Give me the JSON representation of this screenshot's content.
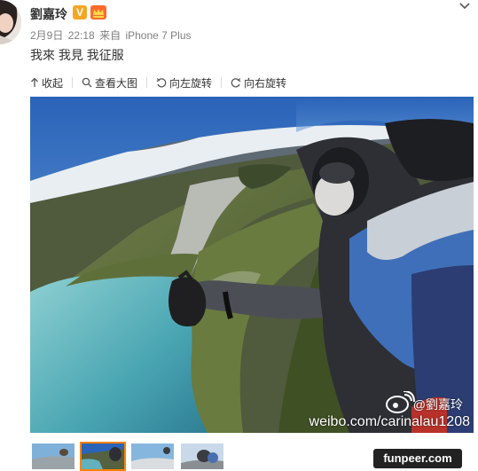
{
  "post": {
    "username": "劉嘉玲",
    "verified_badge": "V",
    "date": "2月9日",
    "time": "22:18",
    "source_prefix": "来自",
    "source": "iPhone 7 Plus",
    "text": "我來 我見 我征服"
  },
  "toolbar": {
    "collapse_label": "收起",
    "view_large_label": "查看大图",
    "rotate_left_label": "向左旋转",
    "rotate_right_label": "向右旋转"
  },
  "photo": {
    "watermark_handle": "@劉嘉玲",
    "watermark_url": "weibo.com/carinalau1208"
  },
  "thumbnails": {
    "count": 4,
    "selected_index": 1
  },
  "site_watermark": "funpeer.com",
  "colors": {
    "accent": "#ff8200",
    "verified": "#f5a623",
    "meta_text": "#808080"
  }
}
